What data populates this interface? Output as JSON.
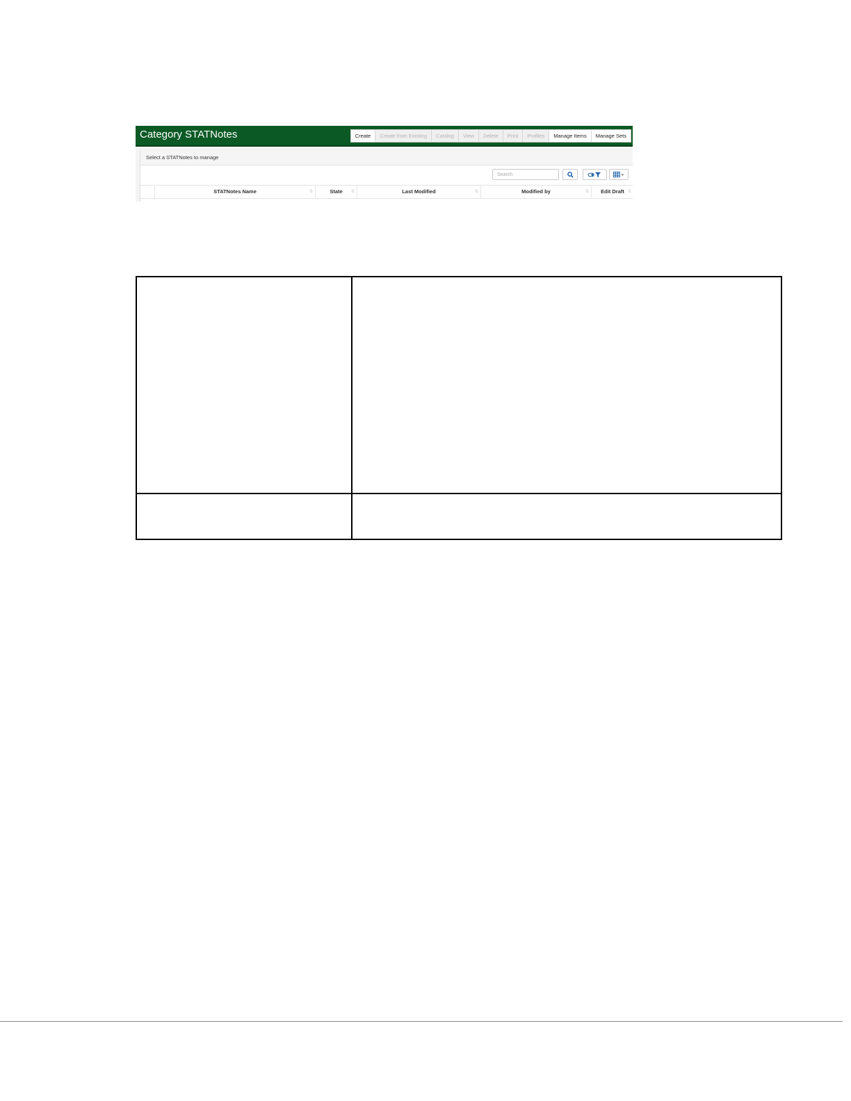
{
  "app": {
    "title": "Category STATNotes",
    "toolbar": [
      {
        "label": "Create",
        "enabled": true
      },
      {
        "label": "Create from Existing",
        "enabled": false
      },
      {
        "label": "Catalog",
        "enabled": false
      },
      {
        "label": "View",
        "enabled": false
      },
      {
        "label": "Delete",
        "enabled": false
      },
      {
        "label": "Print",
        "enabled": false
      },
      {
        "label": "Profiles",
        "enabled": false
      },
      {
        "label": "Manage Items",
        "enabled": true
      },
      {
        "label": "Manage Sets",
        "enabled": true
      }
    ]
  },
  "panel": {
    "heading": "Select a STATNotes to manage",
    "search": {
      "placeholder": "Search",
      "value": ""
    },
    "icons": {
      "search": "search-icon",
      "filter": "filter-icon",
      "columns": "columns-icon"
    }
  },
  "table": {
    "columns": [
      "",
      "STATNotes Name",
      "State",
      "Last Modified",
      "Modified by",
      "Edit Draft"
    ]
  },
  "colors": {
    "brand": "#0b5a25",
    "accent": "#1a5fa6"
  }
}
